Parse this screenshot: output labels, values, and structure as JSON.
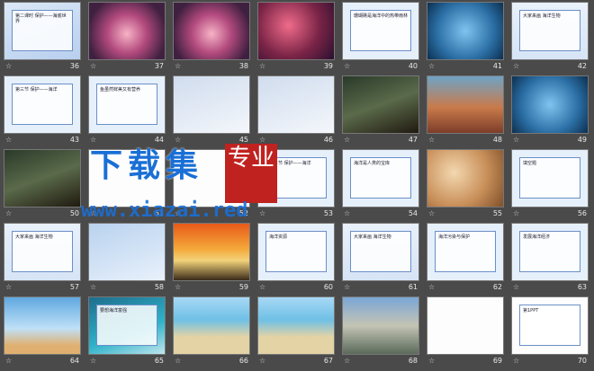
{
  "slides": [
    {
      "num": "36",
      "style": "bg-blue",
      "text": "第二课时 保护——海底世界"
    },
    {
      "num": "37",
      "style": "bg-anemone",
      "text": ""
    },
    {
      "num": "38",
      "style": "bg-anemone",
      "text": ""
    },
    {
      "num": "39",
      "style": "bg-coral",
      "text": ""
    },
    {
      "num": "40",
      "style": "bg-paper",
      "text": "珊瑚礁是海洋中的热带雨林"
    },
    {
      "num": "41",
      "style": "bg-fish",
      "text": ""
    },
    {
      "num": "42",
      "style": "bg-chart",
      "text": "大家来画 海洋生物"
    },
    {
      "num": "43",
      "style": "bg-paper",
      "text": "第三节 保护——海洋"
    },
    {
      "num": "44",
      "style": "bg-paper",
      "text": "鱼虽然鲜美又有营养"
    },
    {
      "num": "45",
      "style": "bg-lamp",
      "text": ""
    },
    {
      "num": "46",
      "style": "bg-lamp",
      "text": ""
    },
    {
      "num": "47",
      "style": "bg-dark",
      "text": ""
    },
    {
      "num": "48",
      "style": "bg-reef",
      "text": ""
    },
    {
      "num": "49",
      "style": "bg-fish",
      "text": ""
    },
    {
      "num": "50",
      "style": "bg-dark",
      "text": ""
    },
    {
      "num": "51",
      "style": "bg-white",
      "text": ""
    },
    {
      "num": "52",
      "style": "bg-white",
      "text": ""
    },
    {
      "num": "53",
      "style": "bg-paper",
      "text": "第三节 保护——海洋"
    },
    {
      "num": "54",
      "style": "bg-paper",
      "text": "海洋是人类的宝库"
    },
    {
      "num": "55",
      "style": "bg-shell",
      "text": ""
    },
    {
      "num": "56",
      "style": "bg-paper",
      "text": "填空题"
    },
    {
      "num": "57",
      "style": "bg-chart",
      "text": "大家来画 海洋生物"
    },
    {
      "num": "58",
      "style": "bg-animals",
      "text": ""
    },
    {
      "num": "59",
      "style": "bg-sunset",
      "text": ""
    },
    {
      "num": "60",
      "style": "bg-paper",
      "text": "海洋资源"
    },
    {
      "num": "61",
      "style": "bg-chart",
      "text": "大家来画 海洋生物"
    },
    {
      "num": "62",
      "style": "bg-paper",
      "text": "海洋污染与保护"
    },
    {
      "num": "63",
      "style": "bg-paper",
      "text": "发展海洋经济"
    },
    {
      "num": "64",
      "style": "bg-sky",
      "text": ""
    },
    {
      "num": "65",
      "style": "bg-teal",
      "text": "要想海洋富强"
    },
    {
      "num": "66",
      "style": "bg-beach",
      "text": ""
    },
    {
      "num": "67",
      "style": "bg-beach",
      "text": ""
    },
    {
      "num": "68",
      "style": "bg-stone",
      "text": ""
    },
    {
      "num": "69",
      "style": "bg-white",
      "text": ""
    },
    {
      "num": "70",
      "style": "bg-white",
      "text": "第1PPT"
    }
  ],
  "star_glyph": "☆",
  "watermark": {
    "title": "下载集",
    "seal": "专业",
    "url": "www.xiazai.red"
  }
}
